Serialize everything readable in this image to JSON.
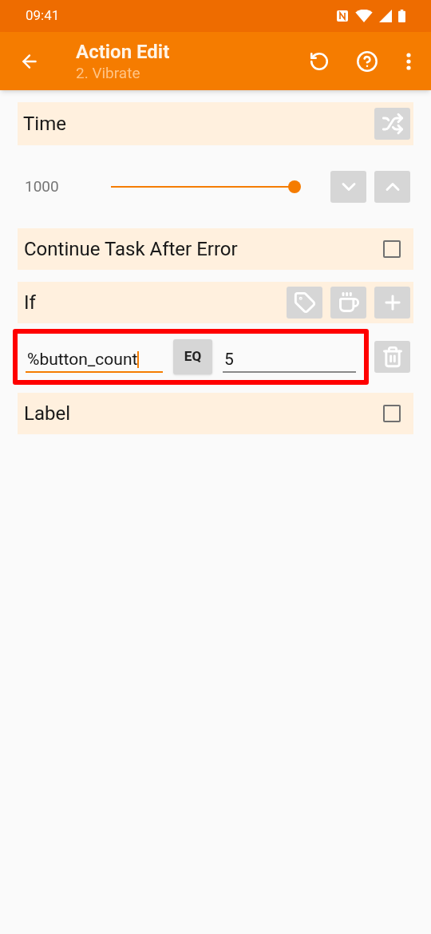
{
  "status_bar": {
    "time": "09:41"
  },
  "app_bar": {
    "title": "Action Edit",
    "subtitle": "2. Vibrate"
  },
  "time_section": {
    "label": "Time",
    "value": "1000",
    "level": 1
  },
  "continue_after_error": {
    "label": "Continue Task After Error",
    "checked": false
  },
  "if_section": {
    "label": "If"
  },
  "condition": {
    "highlighted": true,
    "left": {
      "value": "%button_count",
      "focused": true
    },
    "operator": "EQ",
    "right": {
      "value": "5",
      "focused": false
    }
  },
  "label_section": {
    "label": "Label",
    "checked": false
  }
}
